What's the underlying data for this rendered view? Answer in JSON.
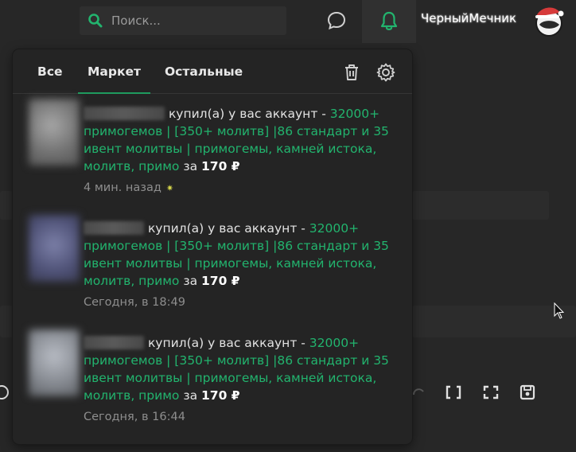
{
  "header": {
    "search_placeholder": "Поиск...",
    "username": "ЧерныйМечник"
  },
  "tabs": [
    {
      "label": "Все"
    },
    {
      "label": "Маркет"
    },
    {
      "label": "Остальные"
    }
  ],
  "notifications": [
    {
      "action": "купил(а) у вас аккаунт - ",
      "item": "32000+ примогемов | [350+ молитв] |86 стандарт и 35 ивент молитвы | примогемы, камней истока, молитв, примо",
      "for_word": " за ",
      "price": "170 ₽",
      "time": "4 мин. назад"
    },
    {
      "action": "купил(а) у вас аккаунт - ",
      "item": "32000+ примогемов | [350+ молитв] |86 стандарт и 35 ивент молитвы | примогемы, камней истока, молитв, примо",
      "for_word": " за ",
      "price": "170 ₽",
      "time": "Сегодня, в 18:49"
    },
    {
      "action": "купил(а) у вас аккаунт - ",
      "item": "32000+ примогемов | [350+ молитв] |86 стандарт и 35 ивент молитвы | примогемы, камней истока, молитв, примо",
      "for_word": " за ",
      "price": "170 ₽",
      "time": "Сегодня, в 16:44"
    }
  ],
  "colors": {
    "accent": "#1f9b5e",
    "link": "#22b46e",
    "background": "#272727",
    "popup": "#242424"
  }
}
